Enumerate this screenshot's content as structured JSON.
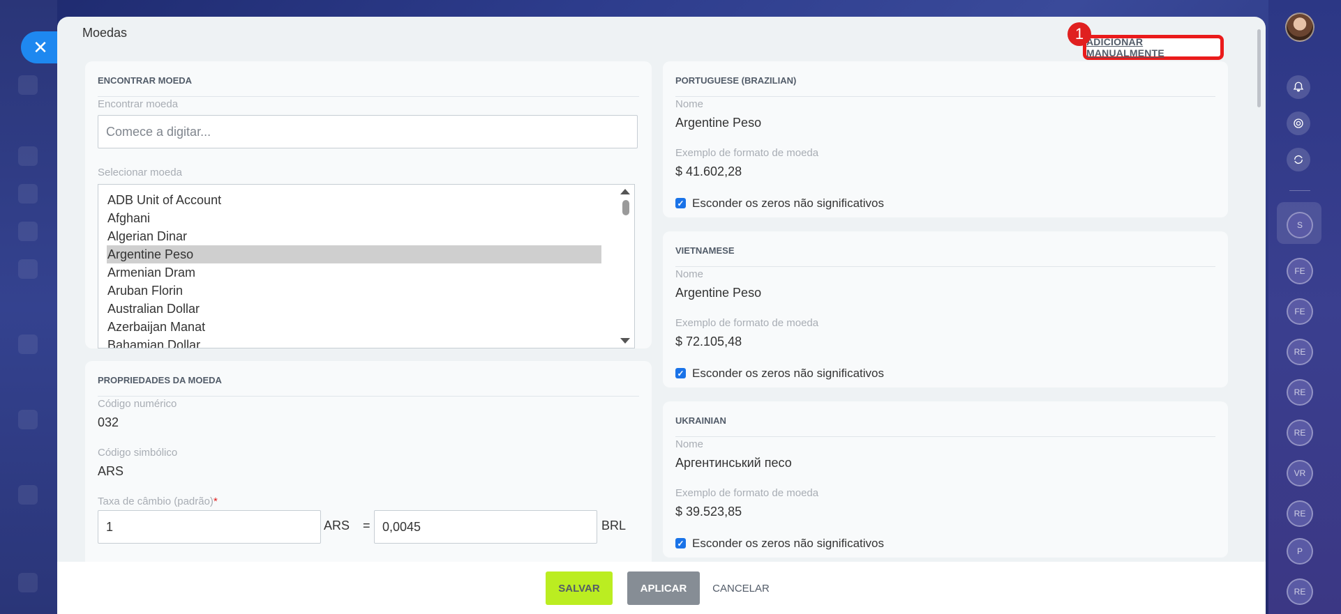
{
  "panel": {
    "title": "Moedas"
  },
  "badge": "1",
  "add_manual_label": "ADICIONAR MANUALMENTE",
  "find_card": {
    "title": "ENCONTRAR MOEDA",
    "search_label": "Encontrar moeda",
    "search_placeholder": "Comece a digitar...",
    "select_label": "Selecionar moeda",
    "items": [
      "ADB Unit of Account",
      "Afghani",
      "Algerian Dinar",
      "Argentine Peso",
      "Armenian Dram",
      "Aruban Florin",
      "Australian Dollar",
      "Azerbaijan Manat",
      "Bahamian Dollar"
    ],
    "selected": "Argentine Peso"
  },
  "props_card": {
    "title": "PROPRIEDADES DA MOEDA",
    "numeric_code_label": "Código numérico",
    "numeric_code": "032",
    "symbol_code_label": "Código simbólico",
    "symbol_code": "ARS",
    "rate_label": "Taxa de câmbio (padrão)",
    "rate_required": "*",
    "rate_left": "1",
    "rate_left_unit": "ARS",
    "equals": "=",
    "rate_right": "0,0045",
    "rate_right_unit": "BRL"
  },
  "lang_cards": [
    {
      "title": "PORTUGUESE (BRAZILIAN)",
      "name_label": "Nome",
      "name": "Argentine Peso",
      "format_label": "Exemplo de formato de moeda",
      "format": "$ 41.602,28",
      "checkbox_label": "Esconder os zeros não significativos"
    },
    {
      "title": "VIETNAMESE",
      "name_label": "Nome",
      "name": "Argentine Peso",
      "format_label": "Exemplo de formato de moeda",
      "format": "$ 72.105,48",
      "checkbox_label": "Esconder os zeros não significativos"
    },
    {
      "title": "UKRAINIAN",
      "name_label": "Nome",
      "name": "Аргентинський песо",
      "format_label": "Exemplo de formato de moeda",
      "format": "$ 39.523,85",
      "checkbox_label": "Esconder os zeros não significativos"
    }
  ],
  "footer": {
    "save": "SALVAR",
    "apply": "APLICAR",
    "cancel": "CANCELAR"
  },
  "rail": {
    "group_initial": "S",
    "avatars": [
      "FE",
      "FE",
      "RE",
      "RE",
      "RE",
      "VR",
      "RE",
      "P",
      "RE"
    ]
  },
  "colors": {
    "accent_blue": "#1e88f0",
    "save_green": "#bbed21",
    "highlight_red": "#ea1b1b"
  }
}
